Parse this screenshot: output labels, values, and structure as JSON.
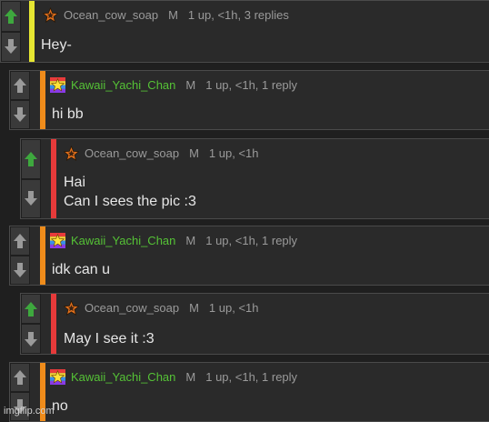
{
  "colors": {
    "up_active": "#3ea83e",
    "vote_inactive": "#9a9a9a",
    "bar_yellow": "#e6e632",
    "bar_orange": "#ef8c1b",
    "bar_red": "#e63a3a",
    "user_grey": "#9a9a9a",
    "user_green": "#55c236"
  },
  "icons": {
    "upvote": "arrow-up-icon",
    "downvote": "arrow-down-icon",
    "star_badge": "star-badge-icon",
    "pixel_badge": "pixel-art-badge-icon"
  },
  "comments": [
    {
      "username": "Ocean_cow_soap",
      "role": "M",
      "meta": "1 up, <1h, 3 replies",
      "lines": [
        "Hey-"
      ]
    },
    {
      "username": "Kawaii_Yachi_Chan",
      "role": "M",
      "meta": "1 up, <1h, 1 reply",
      "lines": [
        "hi bb"
      ]
    },
    {
      "username": "Ocean_cow_soap",
      "role": "M",
      "meta": "1 up, <1h",
      "lines": [
        "Hai",
        "Can I sees the pic :3"
      ]
    },
    {
      "username": "Kawaii_Yachi_Chan",
      "role": "M",
      "meta": "1 up, <1h, 1 reply",
      "lines": [
        "idk can u"
      ]
    },
    {
      "username": "Ocean_cow_soap",
      "role": "M",
      "meta": "1 up, <1h",
      "lines": [
        "May I see it :3"
      ]
    },
    {
      "username": "Kawaii_Yachi_Chan",
      "role": "M",
      "meta": "1 up, <1h, 1 reply",
      "lines": [
        "no"
      ]
    }
  ],
  "watermark": "imgflip.com"
}
